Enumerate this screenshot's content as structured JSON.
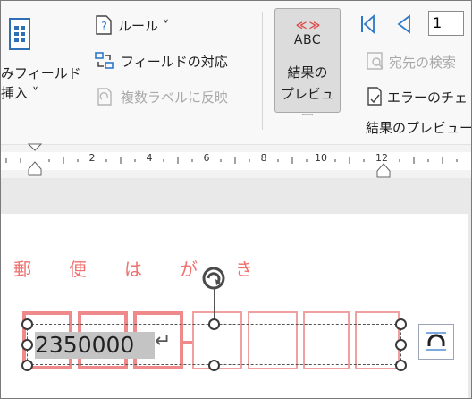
{
  "ribbon": {
    "insert_field_line1": "みフィールド",
    "insert_field_line2": "挿入 ˅",
    "rules_label": "ルール ˅",
    "match_fields_label": "フィールドの対応",
    "update_labels_label": "複数ラベルに反映",
    "preview_chevrons": "≪ ≫",
    "preview_abc": "ABC",
    "preview_label_line1": "結果の",
    "preview_label_line2": "プレビュー",
    "record_number": "1",
    "find_recipient_label": "宛先の検索",
    "check_errors_label": "エラーのチェ",
    "group_label": "結果のプレビュー"
  },
  "ruler": {
    "numbers": [
      "2",
      "4",
      "6",
      "8",
      "10",
      "12"
    ]
  },
  "document": {
    "postal_heading": [
      "郵",
      "便",
      "は",
      "が",
      "き"
    ],
    "postal_code": "2350000",
    "return_mark": "↵"
  },
  "colors": {
    "accent_red": "#f07070",
    "nav_blue": "#2f78c8"
  }
}
